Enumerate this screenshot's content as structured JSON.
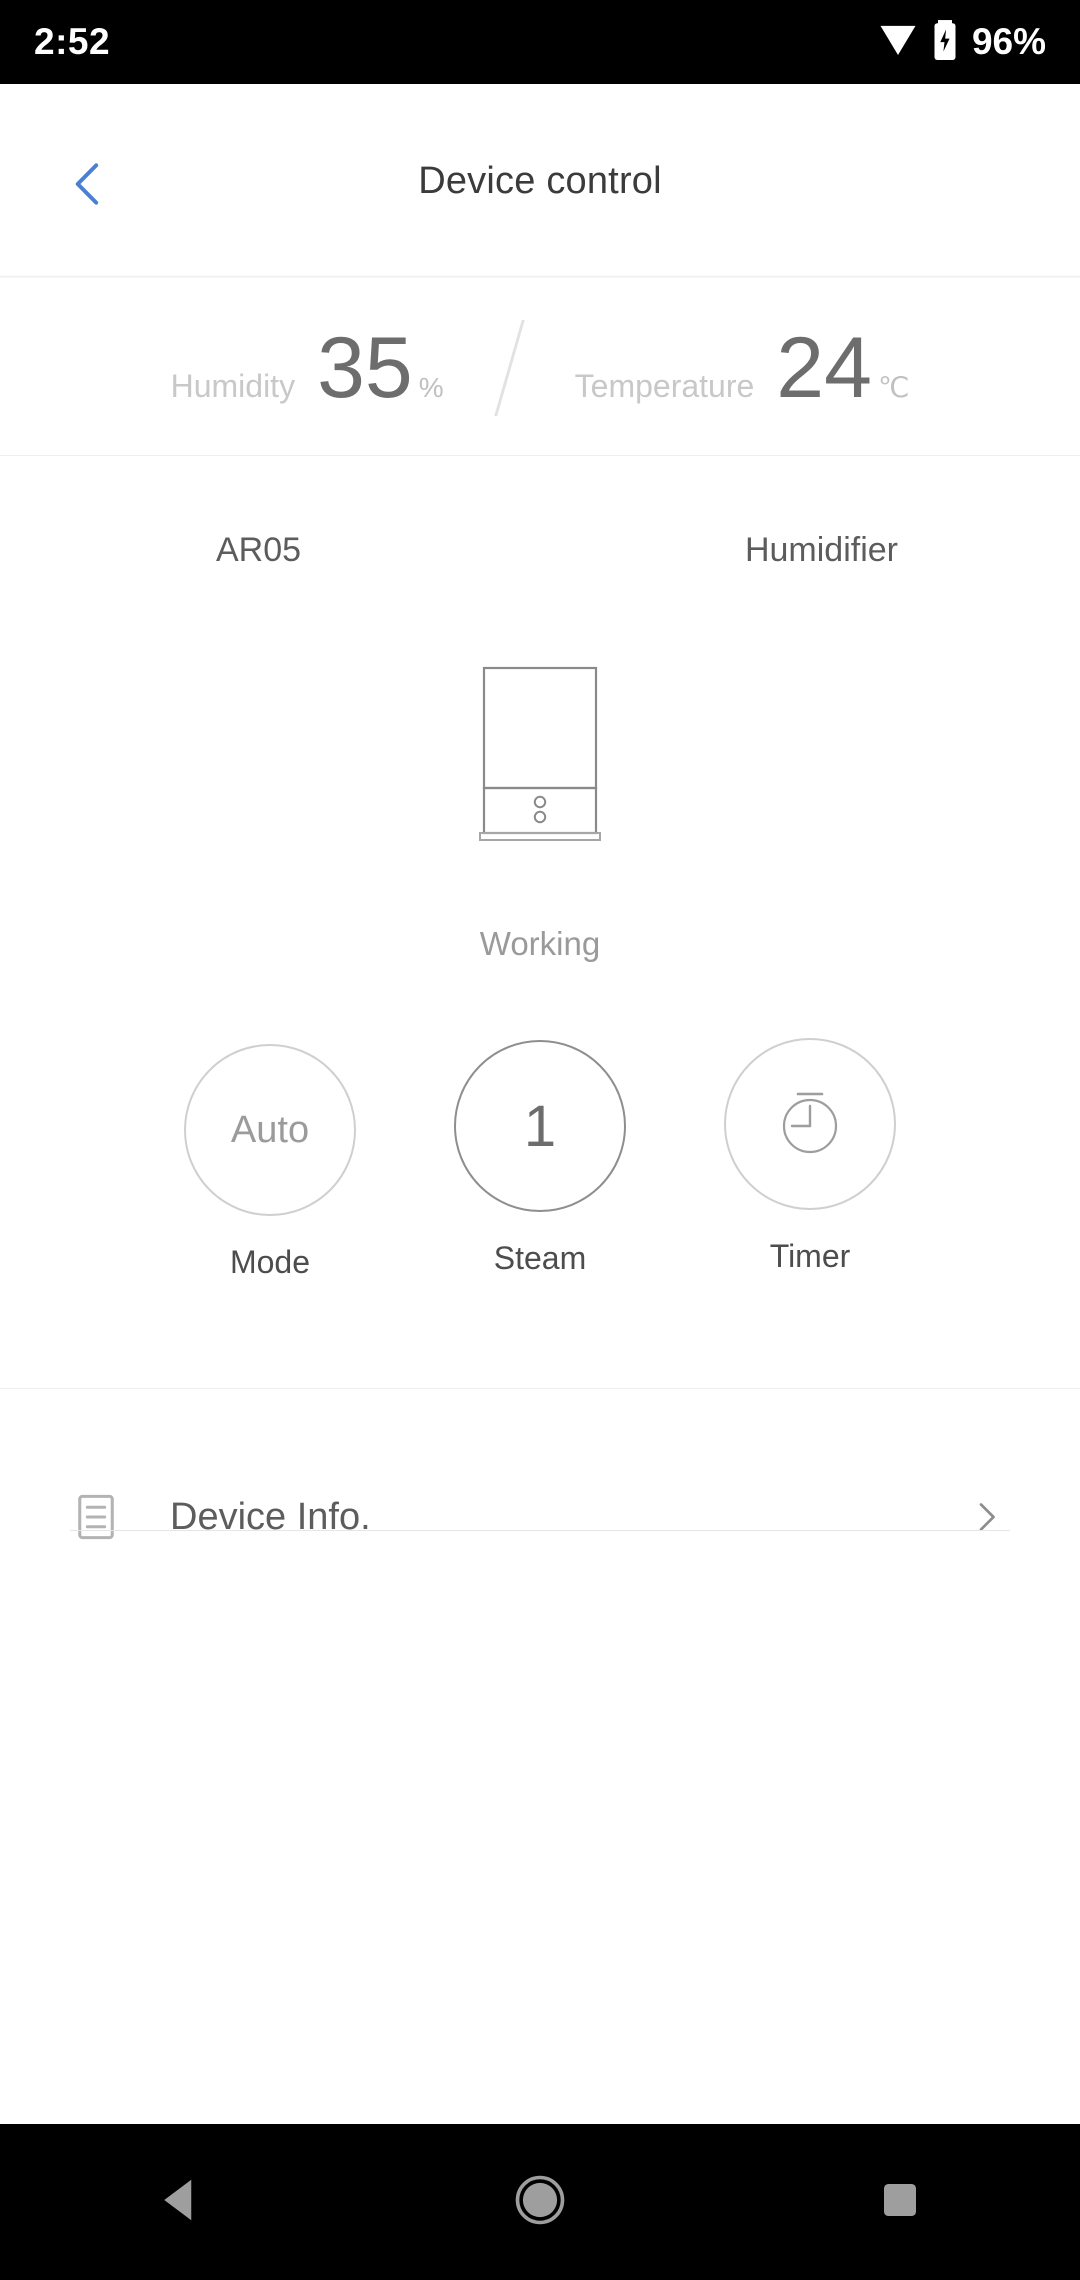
{
  "status_bar": {
    "time": "2:52",
    "battery_percent": "96%",
    "wifi_icon": "wifi-icon",
    "battery_icon": "battery-charging-icon"
  },
  "app_bar": {
    "title": "Device control",
    "back_icon": "chevron-left-icon",
    "back_color": "#4a7fd4"
  },
  "readouts": {
    "humidity": {
      "label": "Humidity",
      "value": "35",
      "unit": "%"
    },
    "temperature": {
      "label": "Temperature",
      "value": "24",
      "unit": "℃"
    }
  },
  "device": {
    "name": "AR05",
    "type": "Humidifier",
    "illustration": "humidifier-icon",
    "status": "Working"
  },
  "controls": [
    {
      "name": "mode",
      "value": "Auto",
      "label": "Mode",
      "kind": "text",
      "active": false
    },
    {
      "name": "steam",
      "value": "1",
      "label": "Steam",
      "kind": "text",
      "active": true
    },
    {
      "name": "timer",
      "value": "",
      "label": "Timer",
      "kind": "icon",
      "icon": "stopwatch-icon",
      "active": false
    }
  ],
  "device_info": {
    "label": "Device Info.",
    "leading_icon": "document-list-icon",
    "trailing_icon": "chevron-right-icon"
  },
  "nav_bar": {
    "back": "back-triangle-icon",
    "home": "home-circle-icon",
    "recents": "recents-square-icon",
    "color": "#9e9e9e"
  },
  "colors": {
    "accent": "#4a7fd4",
    "text_primary": "#3b3b3b",
    "text_secondary": "#6d6d6d",
    "text_muted": "#9a9a9a",
    "text_faint": "#c8c8c8",
    "divider": "#efefef",
    "background": "#ffffff",
    "bar_background": "#000000"
  }
}
